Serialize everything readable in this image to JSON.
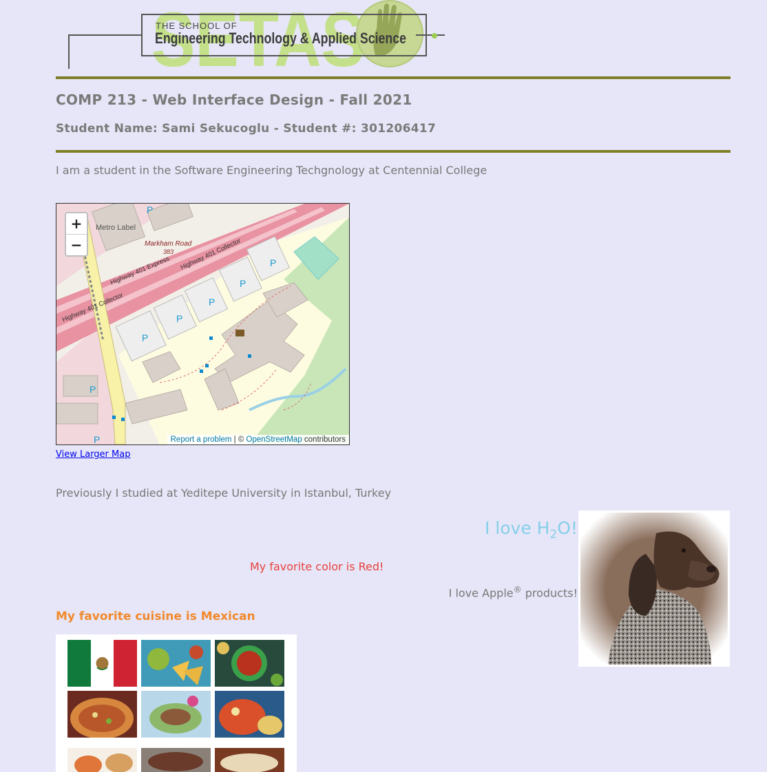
{
  "header": {
    "school_small": "THE SCHOOL OF",
    "school_name": "Engineering Technology & Applied Science",
    "logo_letters": "SETAS"
  },
  "course_title": "COMP 213 - Web Interface Design - Fall 2021",
  "student_line": "Student Name: Sami Sekucoglu - Student #: 301206417",
  "intro": "I am a student in the Software Engineering Techgnology at Centennial College",
  "map": {
    "zoom_in": "+",
    "zoom_out": "−",
    "labels": {
      "metro": "Metro Label",
      "markham": "Markham Road",
      "route": "383",
      "hwy_express": "Highway 401 Express",
      "hwy_collector_1": "Highway 401 Collector",
      "hwy_collector_2": "Highway 401 Collector",
      "parking": "P"
    },
    "attribution": {
      "report": "Report a problem",
      "sep": " | © ",
      "osm": "OpenStreetMap",
      "contributors": " contributors"
    }
  },
  "view_larger": "View Larger Map",
  "previous": "Previously I studied at Yeditepe University in Istanbul, Turkey",
  "h2o": {
    "pre": "I love H",
    "sub": "2",
    "post": "O!"
  },
  "favorite_color": "My favorite color is Red!",
  "apple": {
    "pre": "I love Apple",
    "sup": "®",
    "post": " products!"
  },
  "cuisine_heading": "My favorite cuisine is Mexican",
  "colors": {
    "background": "#e6e6f8",
    "rule": "#7f7f2a",
    "h2o": "#86cfe8",
    "red_text": "#e8413c",
    "orange_heading": "#f1892d",
    "link": "#0000ee"
  }
}
